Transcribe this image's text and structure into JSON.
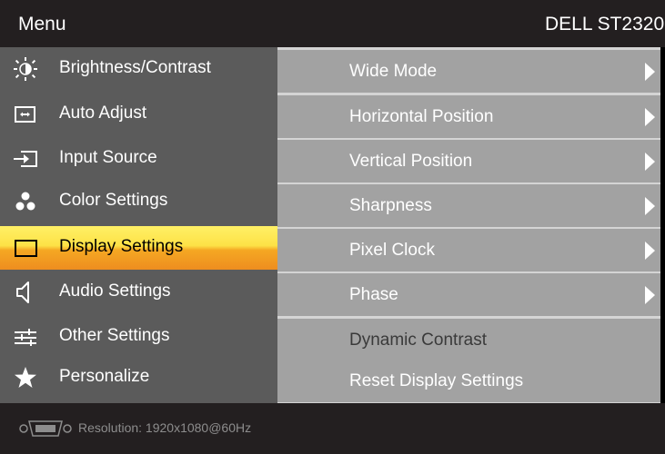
{
  "header": {
    "menu_title": "Menu",
    "model": "DELL ST2320"
  },
  "sidebar": {
    "items": [
      {
        "label": "Brightness/Contrast",
        "icon": "brightness-icon",
        "active": false
      },
      {
        "label": "Auto Adjust",
        "icon": "auto-adjust-icon",
        "active": false
      },
      {
        "label": "Input Source",
        "icon": "input-source-icon",
        "active": false
      },
      {
        "label": "Color Settings",
        "icon": "color-settings-icon",
        "active": false
      },
      {
        "label": "Display Settings",
        "icon": "display-icon",
        "active": true
      },
      {
        "label": "Audio Settings",
        "icon": "speaker-icon",
        "active": false
      },
      {
        "label": "Other Settings",
        "icon": "sliders-icon",
        "active": false
      },
      {
        "label": "Personalize",
        "icon": "star-icon",
        "active": false
      }
    ]
  },
  "submenu": {
    "items": [
      {
        "label": "Wide Mode",
        "has_arrow": true
      },
      {
        "label": "Horizontal Position",
        "has_arrow": true
      },
      {
        "label": "Vertical Position",
        "has_arrow": true
      },
      {
        "label": "Sharpness",
        "has_arrow": true
      },
      {
        "label": "Pixel Clock",
        "has_arrow": true
      },
      {
        "label": "Phase",
        "has_arrow": true
      },
      {
        "label": "Dynamic Contrast",
        "has_arrow": false
      },
      {
        "label": "Reset Display Settings",
        "has_arrow": false
      }
    ]
  },
  "footer": {
    "connector_icon": "vga-connector-icon",
    "resolution": "Resolution:  1920x1080@60Hz"
  },
  "colors": {
    "header_bg": "#231f20",
    "sidebar_bg": "#5b5b5b",
    "submenu_row_bg": "#a2a2a2",
    "submenu_gap": "#d4d4d4",
    "highlight_top": "#fde246",
    "highlight_bottom": "#ee8d1f"
  }
}
